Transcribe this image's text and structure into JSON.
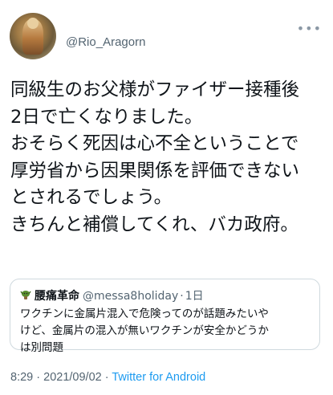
{
  "author": {
    "handle": "@Rio_Aragorn",
    "avatar_icon": "portrait-painting-avatar"
  },
  "more_icon": "more-horizontal-icon",
  "tweet_lines": [
    "同級生のお父様がファイザー接種後",
    "2日で亡くなりました。",
    "おそらく死因は心不全ということで",
    "厚労省から因果関係を評価できない",
    "とされるでしょう。",
    "きちんと補償してくれ、バカ政府。"
  ],
  "quoted": {
    "icon": "leaf-character-icon",
    "name": "腰痛革命",
    "handle": "@messa8holiday",
    "separator": "·",
    "time": "1日",
    "lines": [
      "ワクチンに金属片混入で危険ってのが話題みたいや",
      "けど、金属片の混入が無いワクチンが安全かどうか",
      "は別問題"
    ]
  },
  "footer": {
    "time": "8:29",
    "separator": "·",
    "date": "2021/09/02",
    "separator2": "·",
    "source": "Twitter for Android"
  },
  "colors": {
    "text": "#0f1419",
    "muted": "#536471",
    "link": "#1d9bf0",
    "border": "#cfd9de"
  }
}
